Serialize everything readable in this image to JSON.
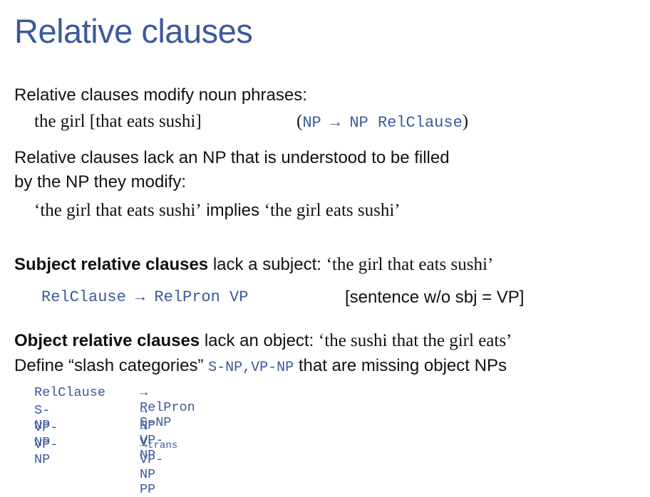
{
  "title": "Relative clauses",
  "line1": "Relative clauses modify noun phrases:",
  "example1": {
    "phrase": "the girl [that eats sushi]",
    "rule_open": "(",
    "rule": "NP → NP RelClause",
    "rule_close": ")"
  },
  "line2a": "Relative clauses lack an NP that is understood to be filled",
  "line2b": "by the NP they modify:",
  "example2": {
    "q1": "‘the girl that eats sushi’",
    "mid": " implies ",
    "q2": "‘the girl eats sushi’"
  },
  "subject": {
    "bold": "Subject relative clauses",
    "rest": " lack a subject: ",
    "quote": "‘the girl that eats sushi’",
    "rule": "RelClause → RelPron VP",
    "note": "[sentence w/o sbj = VP]"
  },
  "object": {
    "bold": "Object relative clauses",
    "rest": " lack an object: ",
    "quote": "‘the sushi that the girl eats’",
    "define_a": "Define “slash categories” ",
    "slash": "S-NP,VP-NP",
    "define_b": " that are missing object NPs"
  },
  "rules": [
    {
      "lhs": "RelClause",
      "rhs": "→ RelPron S-NP",
      "sub": ""
    },
    {
      "lhs": "S-NP",
      "rhs": "→ NP VP-NP",
      "sub": ""
    },
    {
      "lhs": "VP-NP",
      "rhs": "→ V",
      "sub": "trans"
    },
    {
      "lhs": "VP-NP",
      "rhs": "→ VP-NP PP",
      "sub": ""
    }
  ]
}
